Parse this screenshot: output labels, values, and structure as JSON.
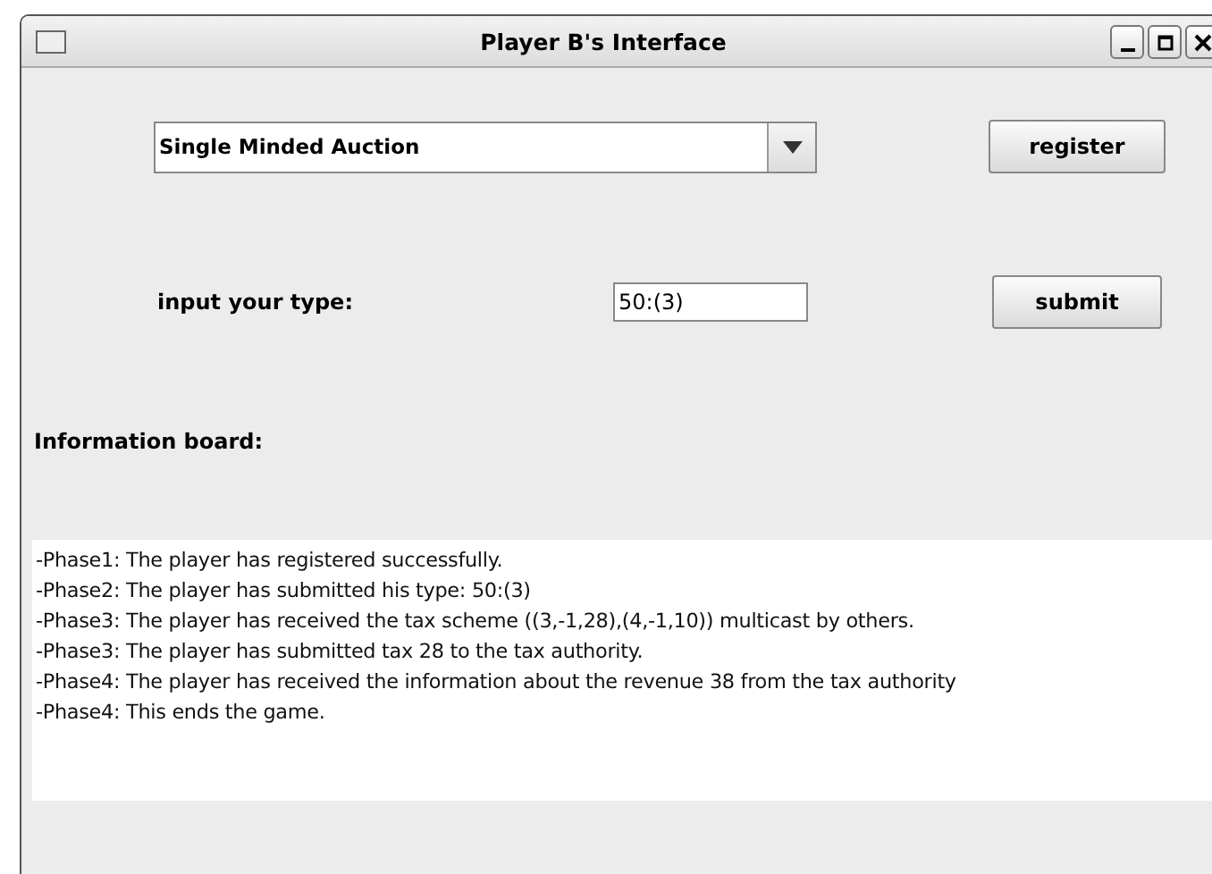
{
  "window": {
    "title": "Player B's Interface"
  },
  "auction_select": {
    "value": "Single Minded Auction"
  },
  "register_button": {
    "label": "register"
  },
  "type_input": {
    "label": "input your type:",
    "value": "50:(3)"
  },
  "submit_button": {
    "label": "submit"
  },
  "information_board": {
    "label": "Information board:",
    "lines": [
      "-Phase1: The player has registered successfully.",
      "-Phase2: The player has submitted his type: 50:(3)",
      "-Phase3: The player has received the tax scheme ((3,-1,28),(4,-1,10)) multicast by others.",
      "-Phase3: The player has submitted tax 28 to the tax authority.",
      "-Phase4: The player has received the information about the revenue 38 from the tax authority",
      "-Phase4: This ends the game."
    ]
  }
}
